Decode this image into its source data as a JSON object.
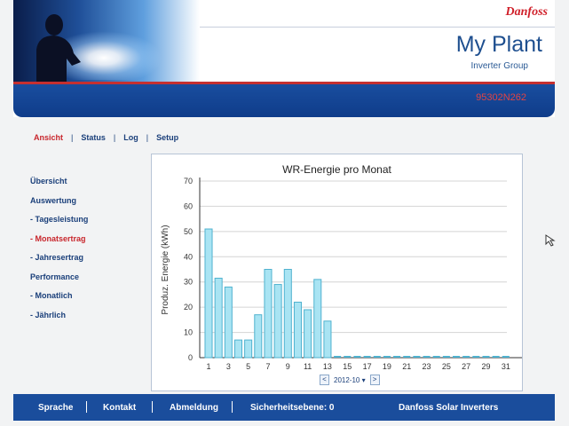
{
  "header": {
    "logo": "Danfoss",
    "title": "My Plant",
    "subtitle": "Inverter Group",
    "serial": "95302N262"
  },
  "main_nav": {
    "items": [
      {
        "label": "Ansicht",
        "active": true
      },
      {
        "label": "Status",
        "active": false
      },
      {
        "label": "Log",
        "active": false
      },
      {
        "label": "Setup",
        "active": false
      }
    ]
  },
  "sidebar": {
    "items": [
      {
        "label": "Übersicht",
        "active": false
      },
      {
        "label": "Auswertung",
        "active": false
      },
      {
        "label": "- Tagesleistung",
        "active": false
      },
      {
        "label": "- Monatsertrag",
        "active": true
      },
      {
        "label": "- Jahresertrag",
        "active": false
      },
      {
        "label": "Performance",
        "active": false
      },
      {
        "label": "- Monatlich",
        "active": false
      },
      {
        "label": "- Jährlich",
        "active": false
      }
    ]
  },
  "month_picker": {
    "prev": "<",
    "value": "2012-10",
    "next": ">"
  },
  "footer": {
    "sprache": "Sprache",
    "kontakt": "Kontakt",
    "abmeldung": "Abmeldung",
    "sicherheit": "Sicherheitsebene: 0",
    "brand": "Danfoss Solar Inverters"
  },
  "colors": {
    "accent_red": "#c8262c",
    "nav_blue": "#1a3f7a",
    "band_blue": "#0f3c8a",
    "bar_fill": "#a9e4f3",
    "bar_stroke": "#4fb2cf"
  },
  "chart_data": {
    "type": "bar",
    "title": "WR-Energie pro Monat",
    "xlabel": "",
    "ylabel": "Produz. Energie (kWh)",
    "ylim": [
      0,
      70
    ],
    "yticks": [
      0,
      10,
      20,
      30,
      40,
      50,
      60,
      70
    ],
    "categories": [
      "1",
      "2",
      "3",
      "4",
      "5",
      "6",
      "7",
      "8",
      "9",
      "10",
      "11",
      "12",
      "13",
      "14",
      "15",
      "16",
      "17",
      "18",
      "19",
      "20",
      "21",
      "22",
      "23",
      "24",
      "25",
      "26",
      "27",
      "28",
      "29",
      "30",
      "31"
    ],
    "xtick_labels": [
      "1",
      "3",
      "5",
      "7",
      "9",
      "11",
      "13",
      "15",
      "17",
      "19",
      "21",
      "23",
      "25",
      "27",
      "29",
      "31"
    ],
    "values": [
      51,
      31.5,
      28,
      7,
      7,
      17,
      35,
      29,
      35,
      22,
      19,
      31,
      14.5,
      0,
      0,
      0,
      0,
      0,
      0,
      0,
      0,
      0,
      0,
      0,
      0,
      0,
      0,
      0,
      0,
      0,
      0
    ],
    "grid": true
  }
}
